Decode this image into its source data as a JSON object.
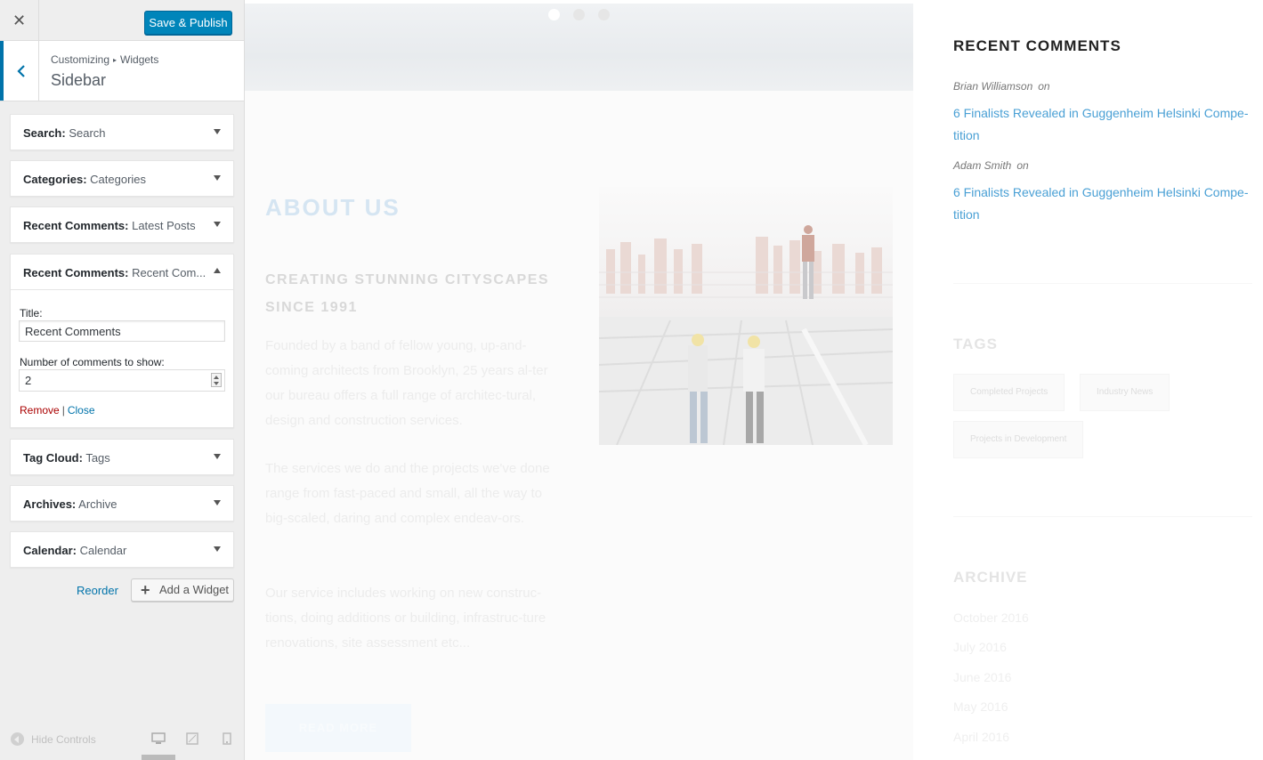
{
  "header": {
    "close_icon": "close-icon",
    "publish_label": "Save & Publish"
  },
  "section": {
    "breadcrumb_root": "Customizing",
    "breadcrumb_sep": "▸",
    "breadcrumb_current": "Widgets",
    "title": "Sidebar"
  },
  "widgets": [
    {
      "type": "Search:",
      "name": "Search"
    },
    {
      "type": "Categories:",
      "name": "Categories"
    },
    {
      "type": "Recent Comments:",
      "name": "Latest Posts"
    },
    {
      "type": "Recent Comments:",
      "name": "Recent Com..."
    },
    {
      "type": "Tag Cloud:",
      "name": "Tags"
    },
    {
      "type": "Archives:",
      "name": "Archive"
    },
    {
      "type": "Calendar:",
      "name": "Calendar"
    }
  ],
  "open_widget": {
    "title_label": "Title:",
    "title_value": "Recent Comments",
    "count_label": "Number of comments to show:",
    "count_value": "2",
    "remove_label": "Remove",
    "separator": "|",
    "close_label": "Close"
  },
  "actions": {
    "reorder_label": "Reorder",
    "add_widget_label": "Add a Widget"
  },
  "footer": {
    "hide_controls_label": "Hide Controls",
    "devices": [
      "desktop-icon",
      "tablet-icon",
      "mobile-icon"
    ]
  },
  "preview": {
    "about_title": "ABOUT US",
    "about_subtitle": "CREATING STUNNING CITYSCAPES SINCE 1991",
    "about_paragraphs": [
      "Founded by a band of fellow young, up-and-coming architects from Brooklyn, 25 years al-ter our bureau offers a full range of architec-tural, design and construction services.",
      "The services we do and the projects we've done range from fast-paced and small, all the way to big-scaled, daring and complex endeav-ors.",
      "Our service includes working on new construc-tions, doing additions or building, infrastruc-ture renovations, site assessment etc..."
    ],
    "read_more": "READ MORE",
    "recent_comments_title": "RECENT COMMENTS",
    "comments": [
      {
        "author": "Brian Williamson",
        "on": "on",
        "post": "6 Finalists Revealed in Guggenheim Helsinki Compe-tition"
      },
      {
        "author": "Adam Smith",
        "on": "on",
        "post": "6 Finalists Revealed in Guggenheim Helsinki Compe-tition"
      }
    ],
    "tags_title": "TAGS",
    "tags": [
      "Completed Projects",
      "Industry News",
      "Projects in Development"
    ],
    "archive_title": "ARCHIVE",
    "archive": [
      "October 2016",
      "July 2016",
      "June 2016",
      "May 2016",
      "April 2016"
    ]
  },
  "colors": {
    "accent": "#0073aa",
    "publish_button": "#0085ba",
    "remove_link": "#aa0000",
    "comment_link": "#4aa0d5"
  }
}
